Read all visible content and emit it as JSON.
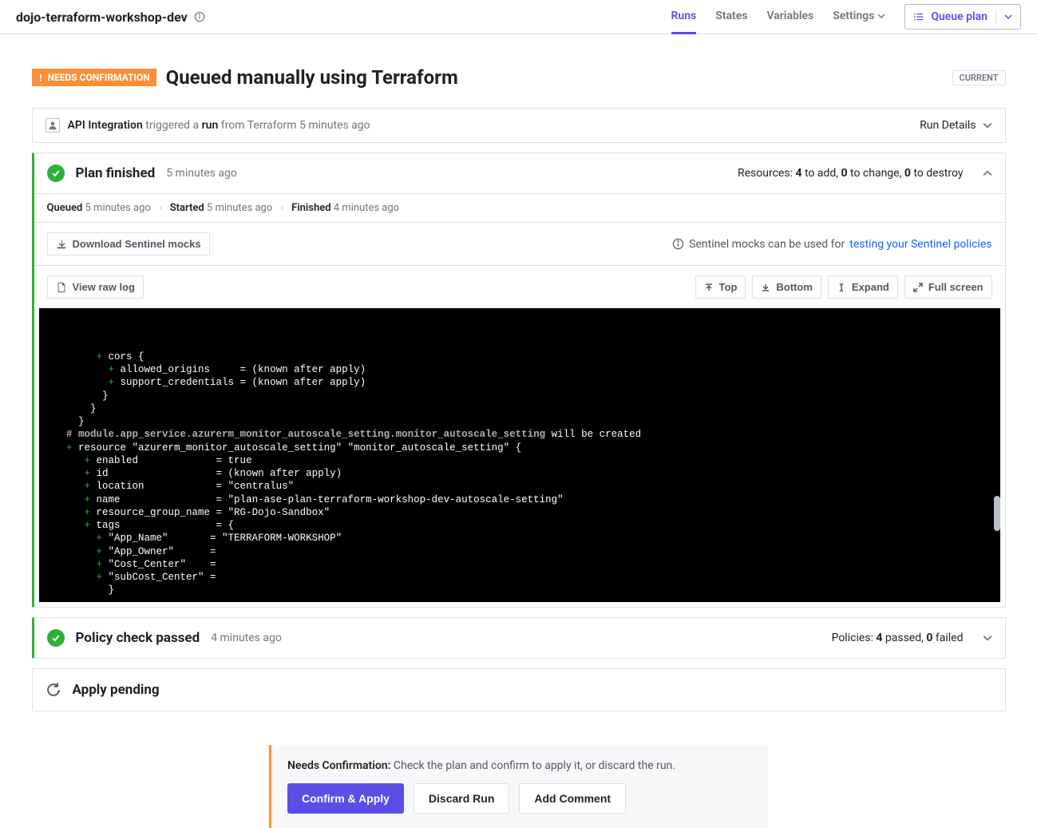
{
  "header": {
    "workspace": "dojo-terraform-workshop-dev",
    "nav": {
      "runs": "Runs",
      "states": "States",
      "variables": "Variables",
      "settings": "Settings"
    },
    "queue_plan": "Queue plan"
  },
  "run": {
    "badge": "NEEDS CONFIRMATION",
    "title": "Queued manually using Terraform",
    "current_badge": "CURRENT"
  },
  "trigger": {
    "actor": "API Integration",
    "mid1": " triggered a ",
    "bold2": "run",
    "tail": " from Terraform 5 minutes ago",
    "details": "Run Details"
  },
  "plan": {
    "title": "Plan finished",
    "timestamp": "5 minutes ago",
    "summary": {
      "prefix": "Resources: ",
      "add_n": "4",
      "add_t": " to add, ",
      "change_n": "0",
      "change_t": " to change, ",
      "destroy_n": "0",
      "destroy_t": " to destroy"
    },
    "timeline": {
      "queued_l": "Queued",
      "queued_t": " 5 minutes ago",
      "started_l": "Started",
      "started_t": " 5 minutes ago",
      "finished_l": "Finished",
      "finished_t": " 4 minutes ago"
    },
    "download_mocks": "Download Sentinel mocks",
    "sentinel_hint": "Sentinel mocks can be used for ",
    "sentinel_link": "testing your Sentinel policies",
    "view_raw": "View raw log",
    "btns": {
      "top": "Top",
      "bottom": "Bottom",
      "expand": "Expand",
      "fullscreen": "Full screen"
    }
  },
  "terminal": [
    {
      "prefix": "        ",
      "plus": "+",
      "txt": " cors {"
    },
    {
      "prefix": "          ",
      "plus": "+",
      "txt": " allowed_origins     = (known after apply)"
    },
    {
      "prefix": "          ",
      "plus": "+",
      "txt": " support_credentials = (known after apply)"
    },
    {
      "prefix": "         ",
      "txt": "}"
    },
    {
      "prefix": "       ",
      "txt": "}"
    },
    {
      "prefix": "     ",
      "txt": "}"
    },
    {
      "prefix": "",
      "txt": ""
    },
    {
      "prefix": "   ",
      "comment": "# module.app_service.azurerm_monitor_autoscale_setting.monitor_autoscale_setting",
      "tail": " will be created"
    },
    {
      "prefix": "   ",
      "plus": "+",
      "txt": " resource \"azurerm_monitor_autoscale_setting\" \"monitor_autoscale_setting\" {"
    },
    {
      "prefix": "      ",
      "plus": "+",
      "txt": " enabled             = true"
    },
    {
      "prefix": "      ",
      "plus": "+",
      "txt": " id                  = (known after apply)"
    },
    {
      "prefix": "      ",
      "plus": "+",
      "txt": " location            = \"centralus\""
    },
    {
      "prefix": "      ",
      "plus": "+",
      "txt": " name                = \"plan-ase-plan-terraform-workshop-dev-autoscale-setting\""
    },
    {
      "prefix": "      ",
      "plus": "+",
      "txt": " resource_group_name = \"RG-Dojo-Sandbox\""
    },
    {
      "prefix": "      ",
      "plus": "+",
      "txt": " tags                = {"
    },
    {
      "prefix": "        ",
      "plus": "+",
      "txt": " \"App_Name\"       = \"TERRAFORM-WORKSHOP\""
    },
    {
      "prefix": "        ",
      "plus": "+",
      "txt": " \"App_Owner\"      ="
    },
    {
      "prefix": "        ",
      "plus": "+",
      "txt": " \"Cost_Center\"    ="
    },
    {
      "prefix": "        ",
      "plus": "+",
      "txt": " \"subCost_Center\" ="
    },
    {
      "prefix": "          ",
      "txt": "}"
    }
  ],
  "policy": {
    "title": "Policy check passed",
    "timestamp": "4 minutes ago",
    "summary": {
      "prefix": "Policies: ",
      "passed_n": "4",
      "passed_t": " passed, ",
      "failed_n": "0",
      "failed_t": " failed"
    }
  },
  "apply": {
    "title": "Apply pending"
  },
  "footer": {
    "label": "Needs Confirmation:",
    "text": " Check the plan and confirm to apply it, or discard the run.",
    "confirm": "Confirm & Apply",
    "discard": "Discard Run",
    "comment": "Add Comment"
  }
}
